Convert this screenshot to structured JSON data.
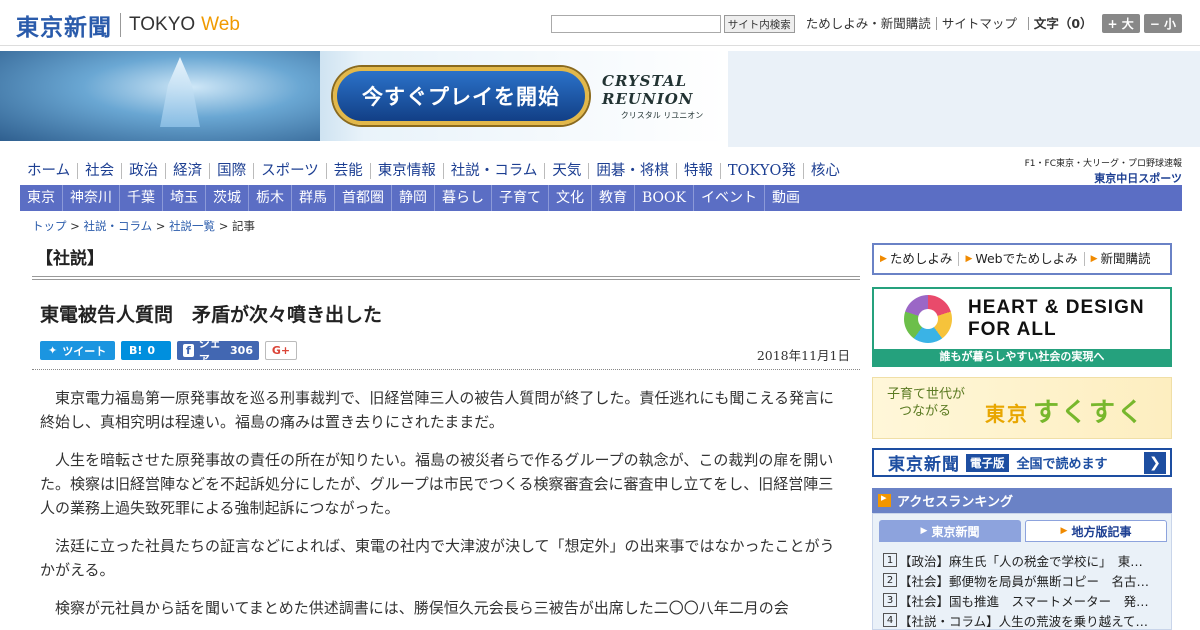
{
  "header": {
    "logo_jp": "東京新聞",
    "logo_en": "TOKYO",
    "logo_web": "Web",
    "search_button": "サイト内検索",
    "links": [
      "ためしよみ・新聞購読",
      "サイトマップ"
    ],
    "font_label": "文字（0）",
    "font_up": "+ 大",
    "font_down": "− 小"
  },
  "banner": {
    "button": "今すぐプレイを開始",
    "logo_title": "CRYSTAL REUNION",
    "logo_sub": "クリスタル リユニオン"
  },
  "nav_primary": [
    "ホーム",
    "社会",
    "政治",
    "経済",
    "国際",
    "スポーツ",
    "芸能",
    "東京情報",
    "社説・コラム",
    "天気",
    "囲碁・将棋",
    "特報",
    "TOKYO発",
    "核心"
  ],
  "nav_primary_right": {
    "line1": "F1・FC東京・大リーグ・プロ野球速報",
    "line2": "東京中日スポーツ"
  },
  "nav_secondary": [
    "東京",
    "神奈川",
    "千葉",
    "埼玉",
    "茨城",
    "栃木",
    "群馬",
    "首都圏",
    "静岡",
    "暮らし",
    "子育て",
    "文化",
    "教育",
    "BOOK",
    "イベント",
    "動画"
  ],
  "breadcrumb": {
    "items": [
      "トップ",
      "社説・コラム",
      "社説一覧"
    ],
    "current": "記事",
    "separator": " > "
  },
  "article": {
    "section": "【社説】",
    "title": "東電被告人質問　矛盾が次々噴き出した",
    "date": "2018年11月1日",
    "social": {
      "tweet": "ツイート",
      "hatena_count": "0",
      "facebook_label": "シェア",
      "facebook_count": "306",
      "gplus": "G+"
    },
    "paragraphs": [
      "東京電力福島第一原発事故を巡る刑事裁判で、旧経営陣三人の被告人質問が終了した。責任逃れにも聞こえる発言に終始し、真相究明は程遠い。福島の痛みは置き去りにされたままだ。",
      "人生を暗転させた原発事故の責任の所在が知りたい。福島の被災者らで作るグループの執念が、この裁判の扉を開いた。検察は旧経営陣などを不起訴処分にしたが、グループは市民でつくる検察審査会に審査申し立てをし、旧経営陣三人の業務上過失致死罪による強制起訴につながった。",
      "法廷に立った社員たちの証言などによれば、東電の社内で大津波が決して「想定外」の出来事ではなかったことがうかがえる。",
      "検察が元社員から話を聞いてまとめた供述調書には、勝俣恒久元会長ら三被告が出席した二〇〇八年二月の会"
    ]
  },
  "sidebar": {
    "links": [
      "ためしよみ",
      "Webでためしよみ",
      "新聞購読"
    ],
    "hd_title_line1": "HEART & DESIGN",
    "hd_title_line2": "FOR ALL",
    "hd_caption": "誰もが暮らしやすい社会の実現へ",
    "suku_small_1": "子育て世代が",
    "suku_small_2": "つながる",
    "suku_city": "東京",
    "suku_big": "すくすく",
    "den_logo": "東京新聞",
    "den_tag": "電子版",
    "den_text": "全国で読めます",
    "ranking_title": "アクセスランキング",
    "tabs": [
      "東京新聞",
      "地方版記事"
    ],
    "ranking": [
      {
        "num": "1",
        "text": "【政治】麻生氏「人の税金で学校に」　東…"
      },
      {
        "num": "2",
        "text": "【社会】郵便物を局員が無断コピー　名古…"
      },
      {
        "num": "3",
        "text": "【社会】国も推進　スマートメーター　発…"
      },
      {
        "num": "4",
        "text": "【社説・コラム】人生の荒波を乗り越えて…"
      }
    ]
  },
  "colors": {
    "brand_blue": "#2a5bab",
    "nav_bar": "#5b6ec4",
    "accent_orange": "#f09a00",
    "green": "#25a17d"
  }
}
